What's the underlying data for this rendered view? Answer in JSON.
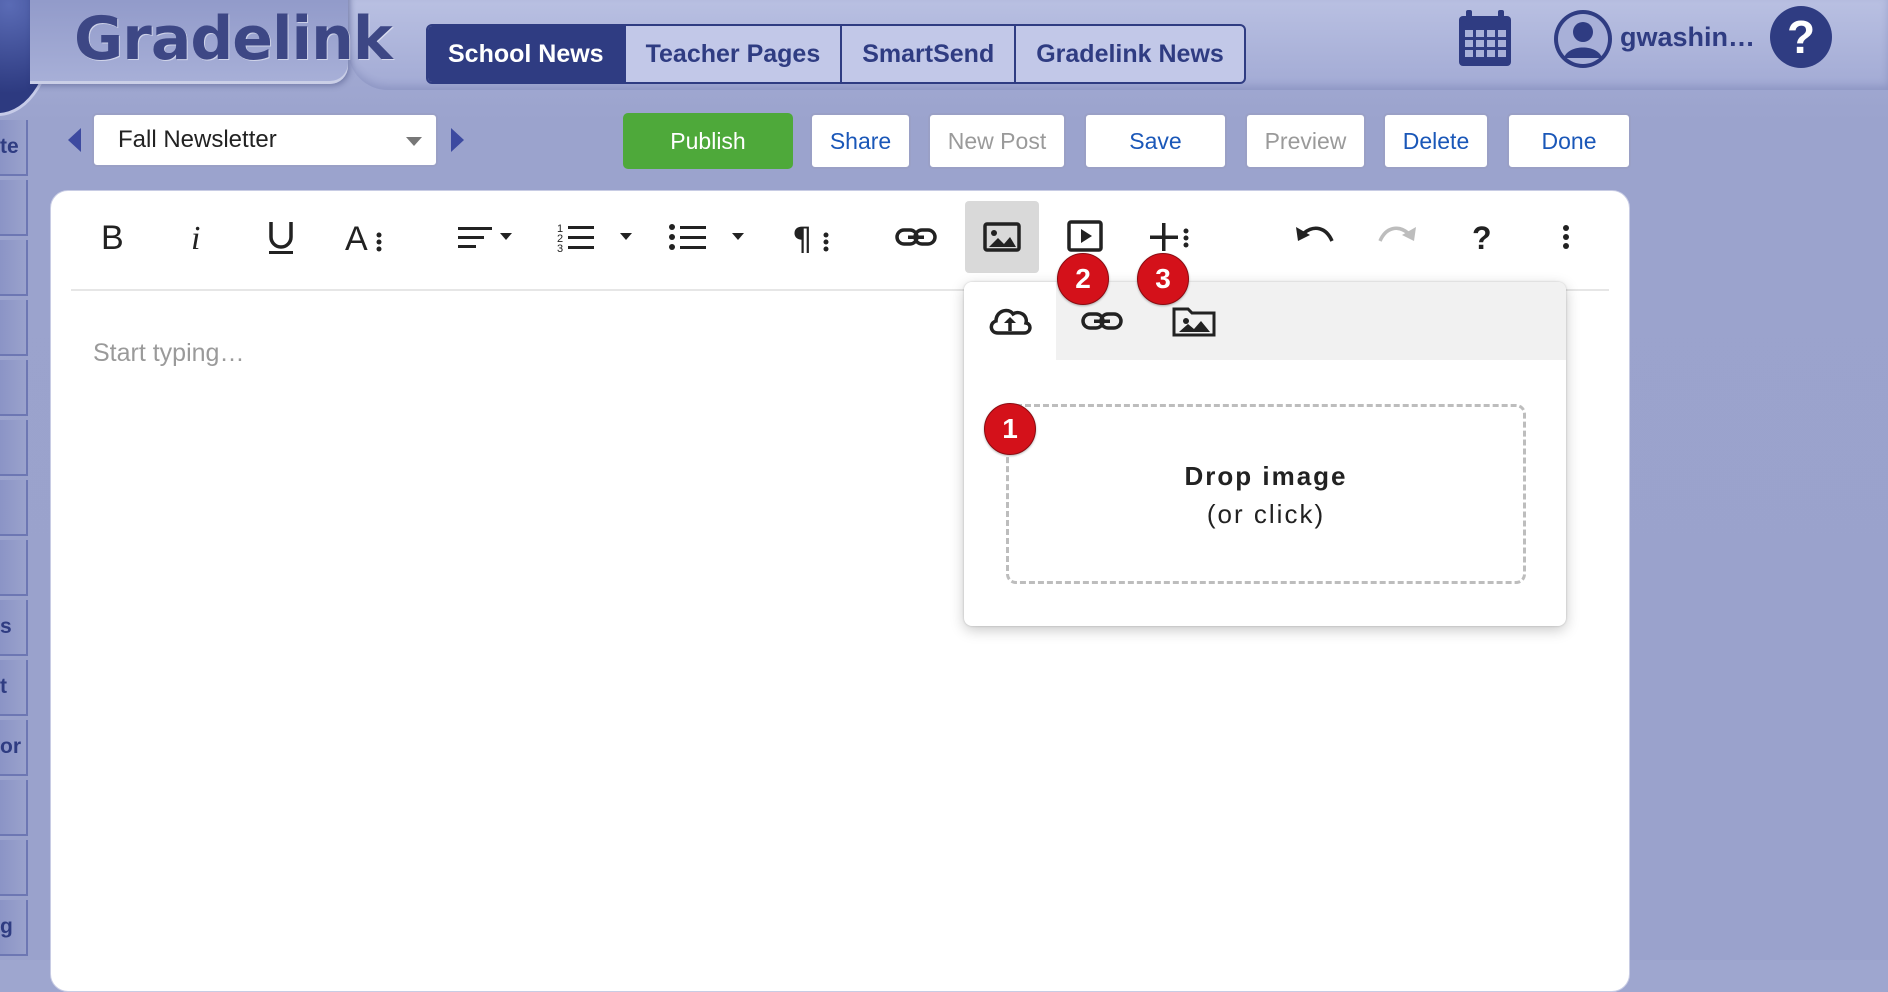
{
  "header": {
    "logo_text": "Gradelink",
    "tabs": [
      {
        "label": "School News",
        "active": true
      },
      {
        "label": "Teacher Pages",
        "active": false
      },
      {
        "label": "SmartSend",
        "active": false
      },
      {
        "label": "Gradelink News",
        "active": false
      }
    ],
    "username": "gwashin…",
    "help_label": "?"
  },
  "sidebar": {
    "fragments": [
      "te",
      "",
      "",
      "",
      "",
      "",
      "",
      "",
      "s",
      "t",
      "or",
      "",
      "",
      "g"
    ]
  },
  "post_bar": {
    "selected_post": "Fall Newsletter",
    "buttons": {
      "publish": "Publish",
      "share": "Share",
      "new_post": "New Post",
      "save": "Save",
      "preview": "Preview",
      "delete": "Delete",
      "done": "Done"
    }
  },
  "editor": {
    "placeholder": "Start typing…",
    "toolbar_icons": [
      "bold-icon",
      "italic-icon",
      "underline-icon",
      "font-size-icon",
      "align-icon",
      "ordered-list-icon",
      "unordered-list-icon",
      "paragraph-format-icon",
      "link-icon",
      "image-icon",
      "video-icon",
      "more-insert-icon",
      "undo-icon",
      "redo-icon",
      "help-icon",
      "more-menu-icon"
    ]
  },
  "image_popup": {
    "tabs": [
      "upload-icon",
      "link-icon",
      "image-manager-icon"
    ],
    "drop_title": "Drop image",
    "drop_subtitle": "(or click)"
  },
  "markers": [
    "1",
    "2",
    "3"
  ],
  "colors": {
    "brand": "#2f3c82",
    "publish": "#4ea93a",
    "link_blue": "#1a57b8",
    "marker_red": "#d4111a"
  }
}
